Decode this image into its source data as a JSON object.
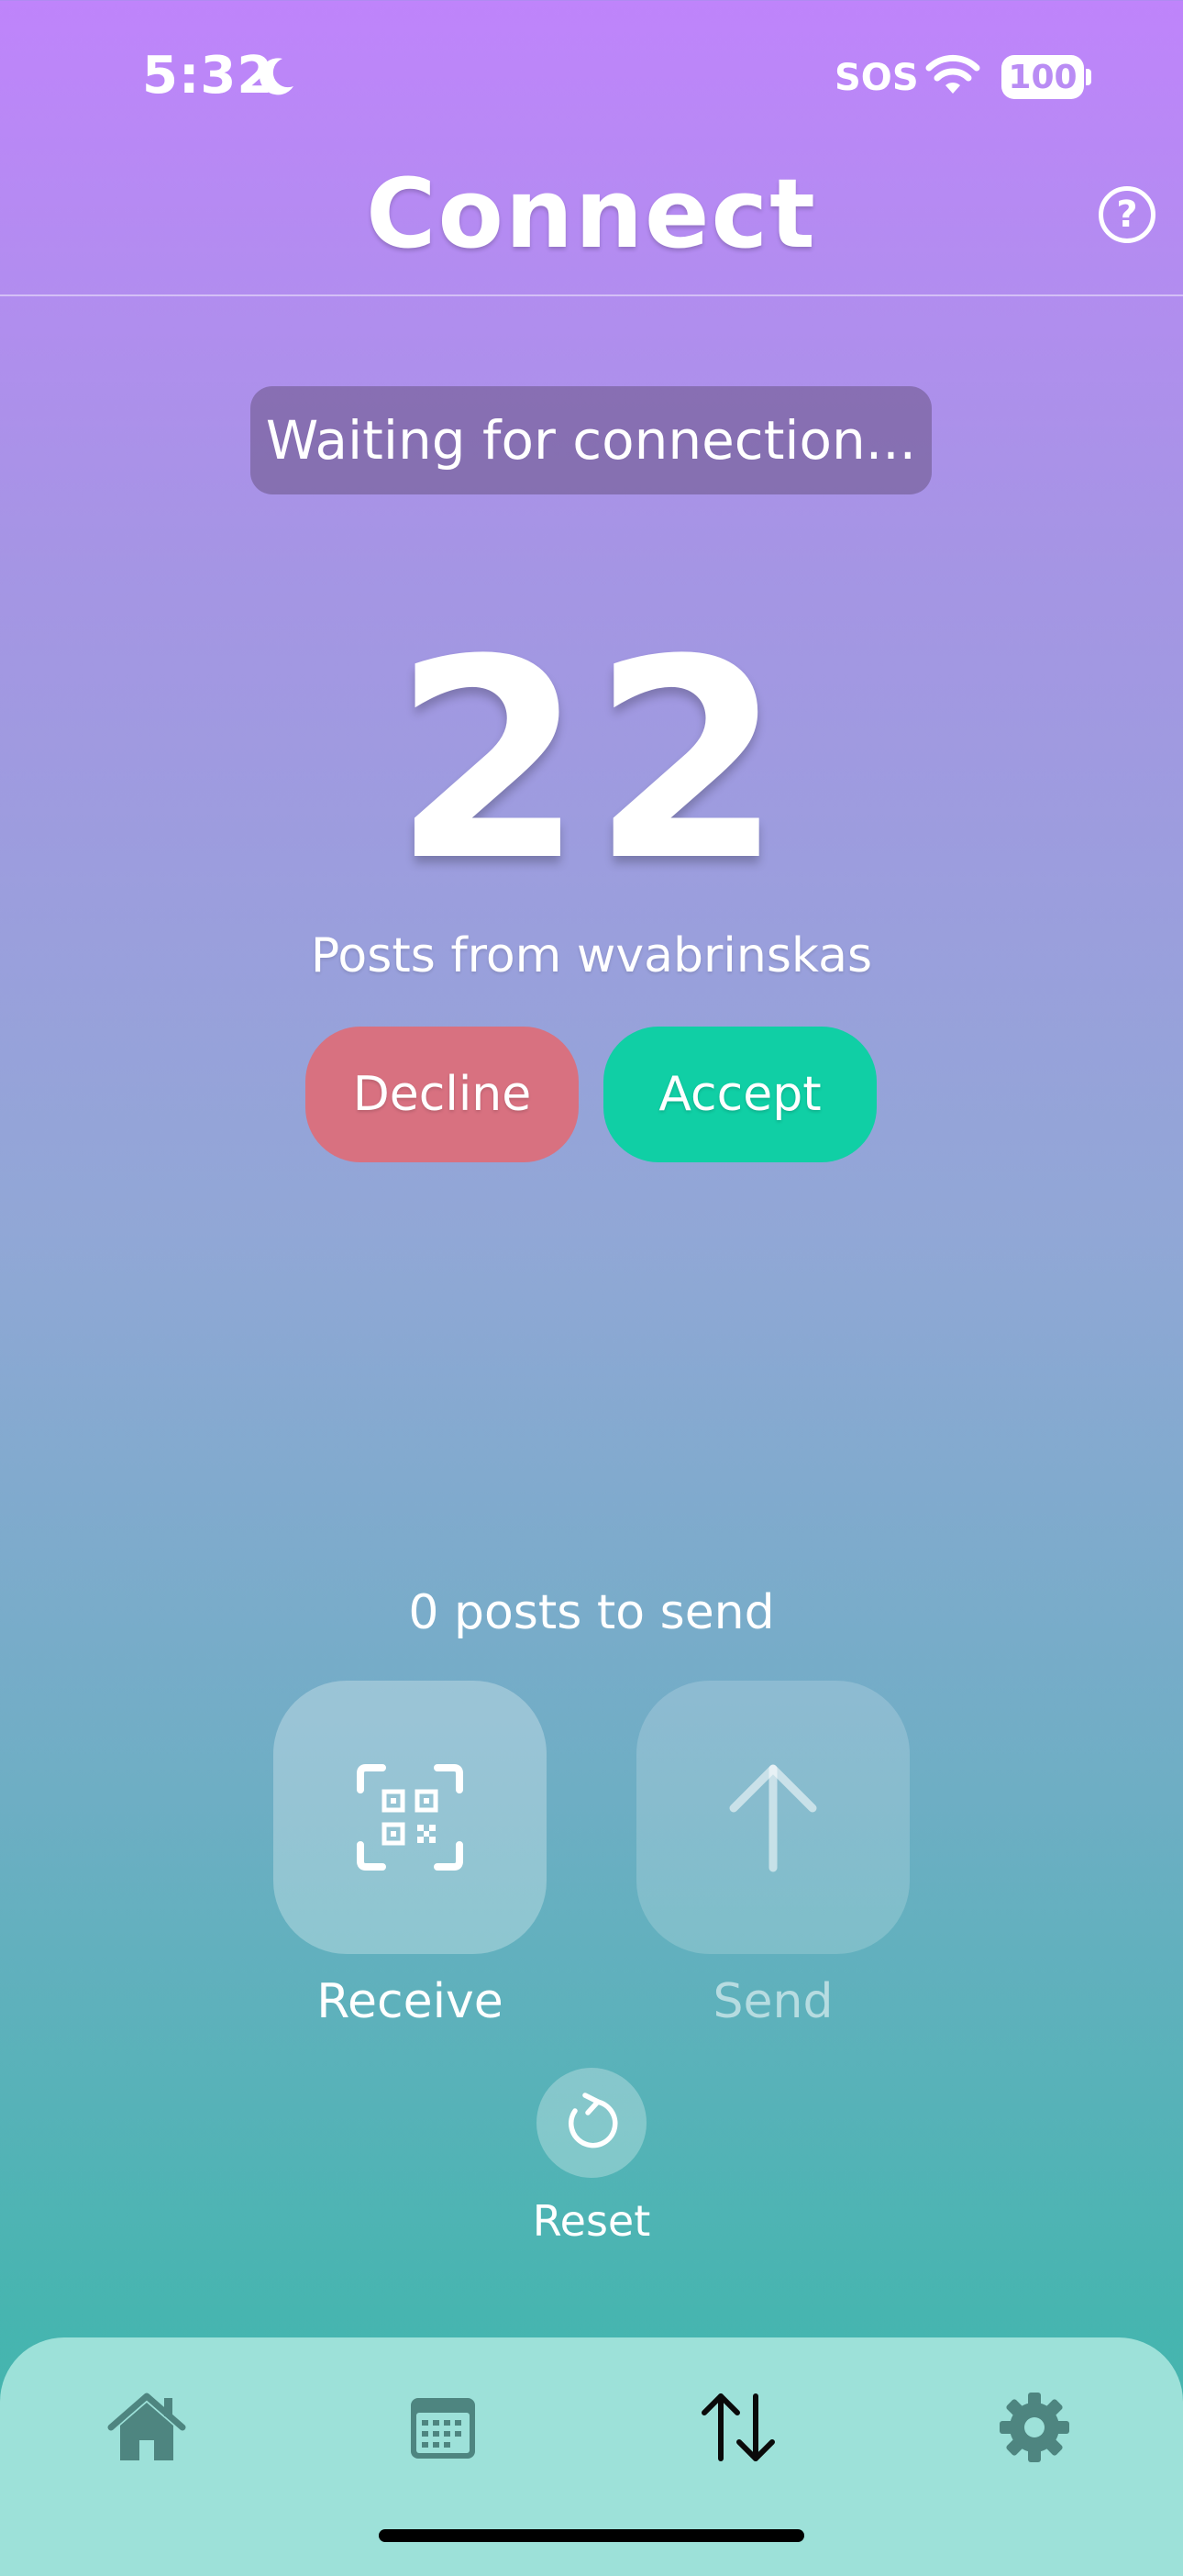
{
  "status_bar": {
    "time": "5:32",
    "carrier": "SOS",
    "battery": "100"
  },
  "header": {
    "title": "Connect",
    "help_label": "?"
  },
  "connection_status": "Waiting for connection...",
  "incoming": {
    "count": "22",
    "label": "Posts from wvabrinskas"
  },
  "actions": {
    "decline_label": "Decline",
    "accept_label": "Accept"
  },
  "outgoing": {
    "to_send_label": "0 posts to send",
    "receive_label": "Receive",
    "send_label": "Send",
    "reset_label": "Reset"
  },
  "tab_bar": {
    "tabs": [
      {
        "icon": "home-icon"
      },
      {
        "icon": "calendar-icon"
      },
      {
        "icon": "transfer-icon",
        "active": true
      },
      {
        "icon": "gear-icon"
      }
    ]
  },
  "colors": {
    "gradient_top": "#bf84fb",
    "gradient_bottom": "#41b4ac",
    "decline": "#d87180",
    "accept": "#10cfa5",
    "tab_bar": "#9de1d9",
    "tab_icon": "#4e8580"
  }
}
